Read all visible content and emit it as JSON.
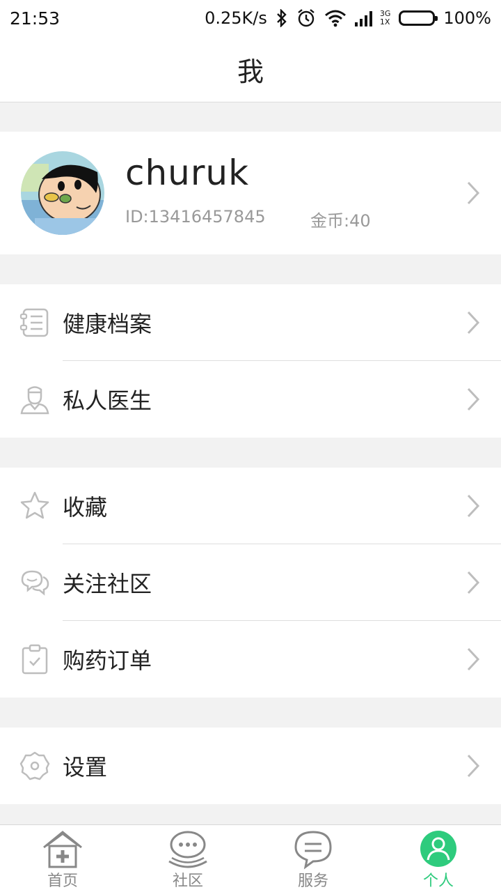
{
  "status_bar": {
    "time": "21:53",
    "speed": "0.25K/s",
    "network_top": "3G",
    "network_bottom": "1X",
    "battery": "100%"
  },
  "header": {
    "title": "我"
  },
  "profile": {
    "name": "churuk",
    "id": "ID:13416457845",
    "coins": "金币:40"
  },
  "groups": [
    {
      "items": [
        {
          "label": "健康档案",
          "icon": "health-record-icon"
        },
        {
          "label": "私人医生",
          "icon": "doctor-icon"
        }
      ]
    },
    {
      "items": [
        {
          "label": "收藏",
          "icon": "star-icon"
        },
        {
          "label": "关注社区",
          "icon": "chat-bubbles-icon"
        },
        {
          "label": "购药订单",
          "icon": "clipboard-check-icon"
        }
      ]
    },
    {
      "items": [
        {
          "label": "设置",
          "icon": "gear-icon"
        }
      ]
    }
  ],
  "tabbar": {
    "items": [
      {
        "label": "首页",
        "icon": "home-icon",
        "active": false
      },
      {
        "label": "社区",
        "icon": "community-icon",
        "active": false
      },
      {
        "label": "服务",
        "icon": "service-icon",
        "active": false
      },
      {
        "label": "个人",
        "icon": "person-icon",
        "active": true
      }
    ]
  },
  "colors": {
    "accent": "#2ecb7d",
    "icon_gray": "#bdbdbd",
    "background": "#f2f2f2"
  }
}
